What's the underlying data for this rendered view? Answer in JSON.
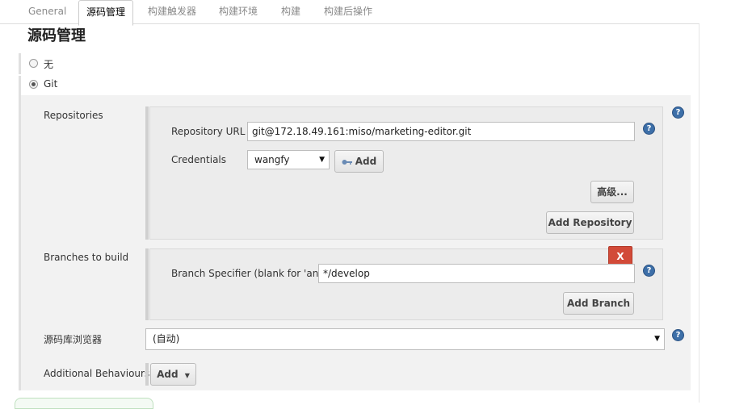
{
  "tabs": [
    {
      "label": "General"
    },
    {
      "label": "源码管理"
    },
    {
      "label": "构建触发器"
    },
    {
      "label": "构建环境"
    },
    {
      "label": "构建"
    },
    {
      "label": "构建后操作"
    }
  ],
  "section_title": "源码管理",
  "scm_options": {
    "none_label": "无",
    "git_label": "Git",
    "selected": "Git"
  },
  "repositories": {
    "label": "Repositories",
    "url_label": "Repository URL",
    "url_value": "git@172.18.49.161:miso/marketing-editor.git",
    "credentials_label": "Credentials",
    "credentials_value": "wangfy",
    "add_label": "Add",
    "advanced_label": "高级...",
    "add_repository_label": "Add Repository"
  },
  "branches": {
    "label": "Branches to build",
    "delete_label": "X",
    "specifier_label": "Branch Specifier (blank for 'any')",
    "specifier_value": "*/develop",
    "add_branch_label": "Add Branch"
  },
  "browser": {
    "label": "源码库浏览器",
    "value": "(自动)"
  },
  "behaviours": {
    "label": "Additional Behaviours",
    "add_label": "Add"
  },
  "icons": {
    "help": "help-icon",
    "key": "key-icon",
    "caret": "caret-down-icon"
  },
  "colors": {
    "help_blue": "#3d6fa8",
    "delete_red": "#d24a38"
  }
}
